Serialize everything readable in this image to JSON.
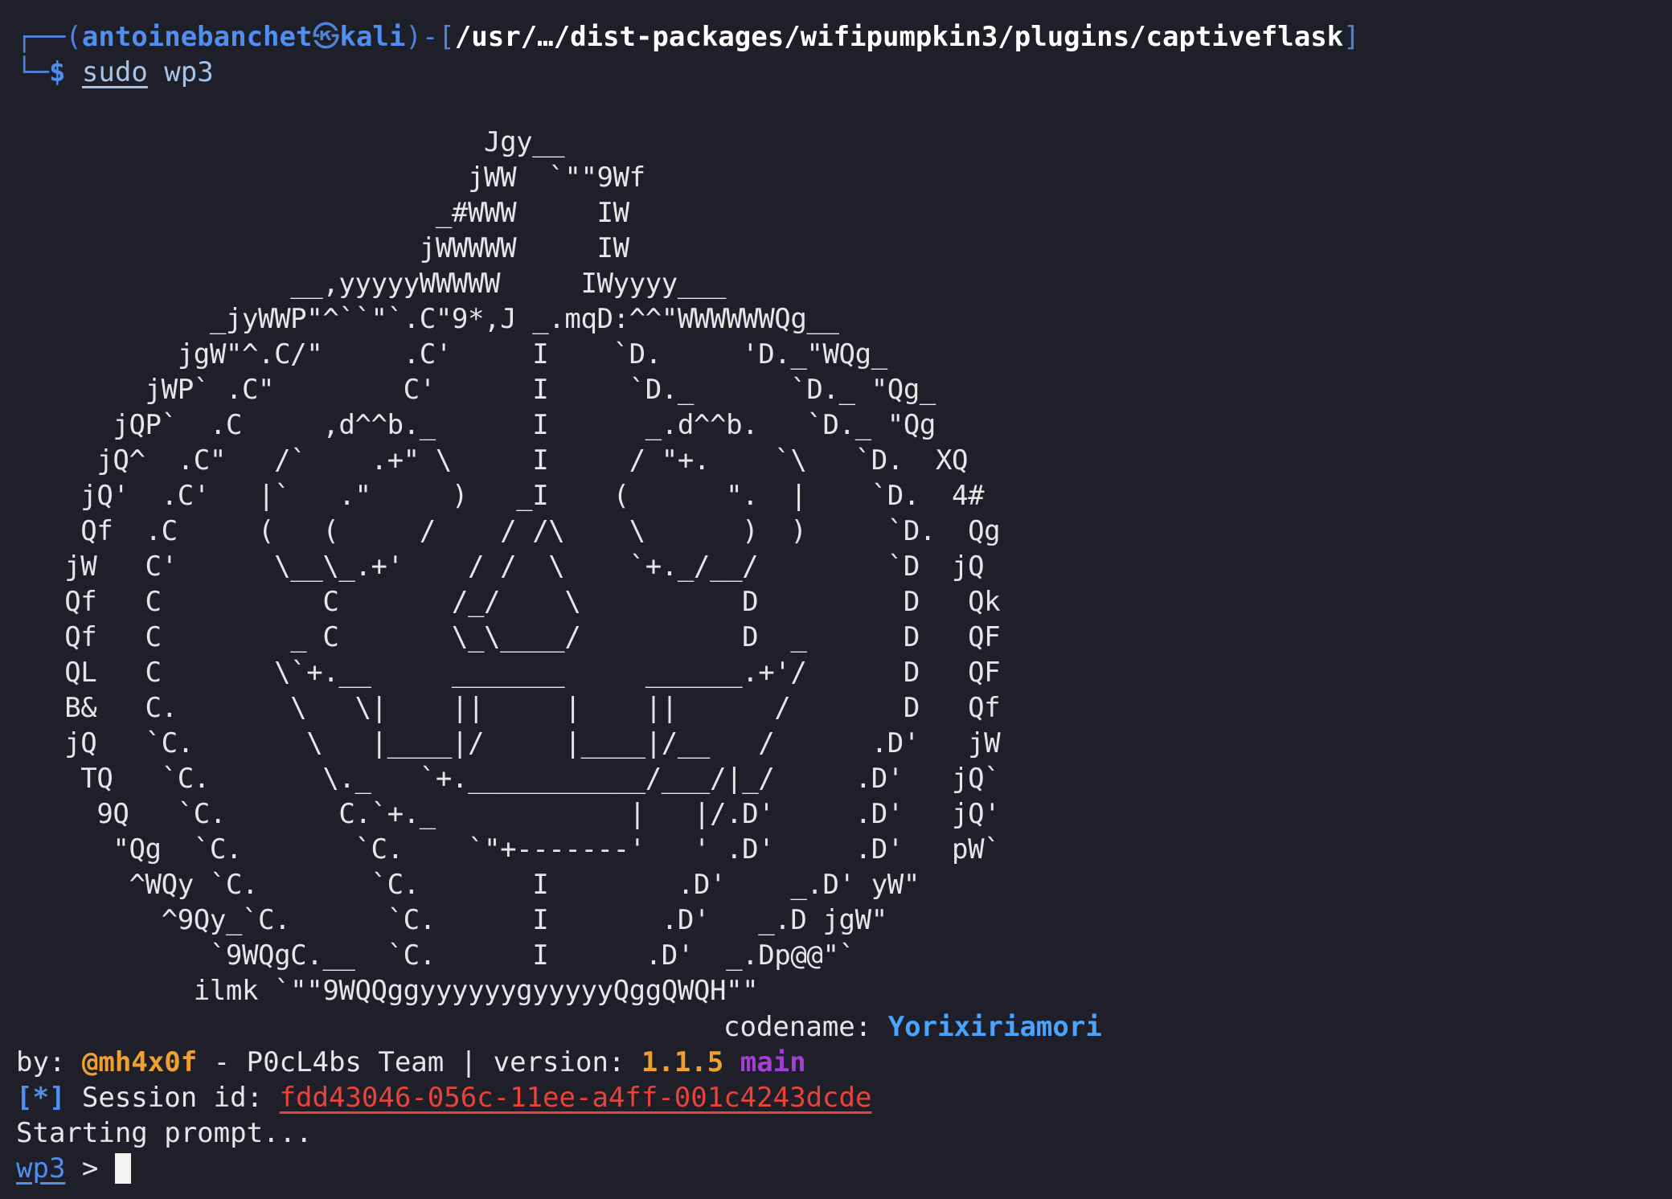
{
  "prompt_header": {
    "frame_top": "┌──(",
    "user": "antoinebanchet",
    "sep_icon": "㉿",
    "host": "kali",
    "mid": ")-[",
    "path": "/usr/…/dist-packages/wifipumpkin3/plugins/captiveflask",
    "close": "]",
    "frame_bottom": "└─",
    "dollar": "$",
    "cmd": "sudo",
    "arg": "wp3"
  },
  "ascii_art": "                             Jgy__\n                            jWW  `\"\"9Wf\n                          _#WWW     IW\n                         jWWWWW     IW\n                 __,yyyyyWWWWW     IWyyyy___\n            _jyWWP\"^``\"`.C\"9*,J _.mqD:^^\"WWWWWWQg__\n          jgW\"^.C/\"     .C'     I    `D.     'D._\"WQg_\n        jWP` .C\"        C'      I     `D._      `D._ \"Qg_\n      jQP`  .C     ,d^^b._      I      _.d^^b.   `D._ \"Qg\n     jQ^  .C\"   /`    .+\" \\     I     / \"+.    `\\   `D.  XQ\n    jQ'  .C'   |`   .\"     )   _I    (      \".  |    `D.  4#\n    Qf  .C     (   (     /    / /\\    \\      )  )     `D.  Qg\n   jW   C'      \\__\\_.+'    / /  \\    `+._/__/        `D  jQ\n   Qf   C          C       /_/    \\          D         D   Qk\n   Qf   C        _ C       \\_\\____/          D  _      D   QF\n   QL   C       \\`+.__     _______     ______.+'/      D   QF\n   B&   C.       \\   \\|    ||     |    ||      /       D   Qf\n   jQ   `C.       \\   |____|/     |____|/__   /      .D'   jW\n    TQ   `C.       \\._   `+.___________/___/|_/     .D'   jQ`\n     9Q   `C.       C.`+._            |   |/.D'     .D'   jQ'\n      \"Qg  `C.       `C.    `\"+-------'   ' .D'     .D'   pW`\n       ^WQy `C.       `C.       I        .D'    _.D' yW\"\n         ^9Qy_`C.      `C.      I       .D'   _.D jgW\"\n            `9WQgC.__  `C.      I      .D'  _.Dp@@\"`\n           ilmk `\"\"9WQQggyyyyyygyyyyyQggQWQH\"\"",
  "banner": {
    "codename_label": "codename: ",
    "codename_value": "Yorixiriamori",
    "by_label": "by: ",
    "author": "@mh4x0f",
    "team": " - P0cL4bs Team | version: ",
    "version": "1.1.5",
    "branch": "main",
    "session_prefix": "[*]",
    "session_label": " Session id: ",
    "session_id": "fdd43046-056c-11ee-a4ff-001c4243dcde",
    "starting": "Starting prompt...",
    "prompt": "wp3",
    "prompt_arrow": " > "
  }
}
